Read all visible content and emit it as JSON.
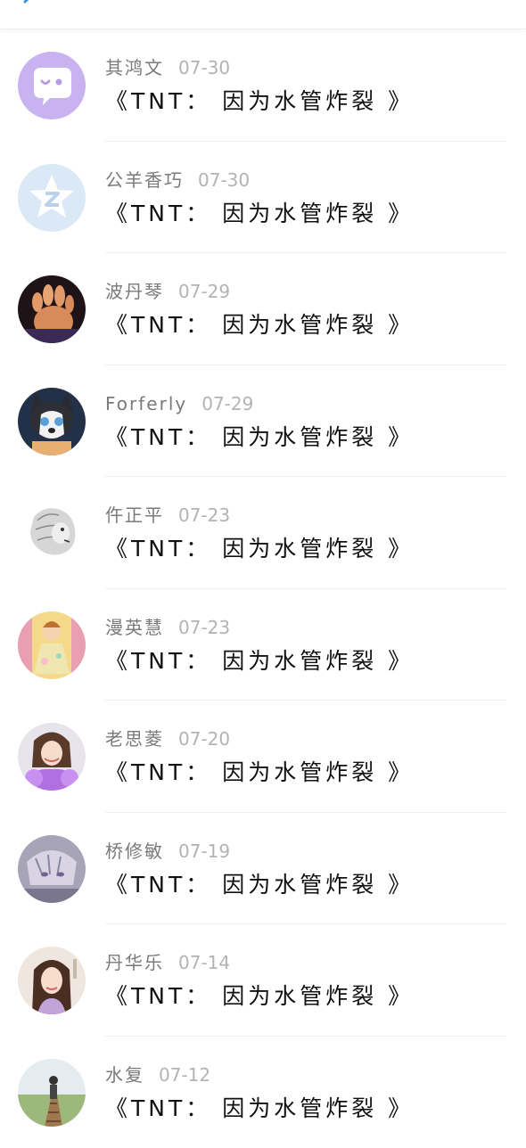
{
  "header": {
    "back_icon": "chevron-left-icon",
    "accent": "#3a8ee6"
  },
  "messages": [
    {
      "name": "其鸿文",
      "date": "07-30",
      "text": "《TNT： 因为水管炸裂 》",
      "avatar": "bubble-face"
    },
    {
      "name": "公羊香巧",
      "date": "07-30",
      "text": "《TNT： 因为水管炸裂 》",
      "avatar": "star-logo"
    },
    {
      "name": "波丹琴",
      "date": "07-29",
      "text": "《TNT： 因为水管炸裂 》",
      "avatar": "paw-photo"
    },
    {
      "name": "Forferly",
      "date": "07-29",
      "text": "《TNT： 因为水管炸裂 》",
      "avatar": "husky-cartoon"
    },
    {
      "name": "仵正平",
      "date": "07-23",
      "text": "《TNT： 因为水管炸裂 》",
      "avatar": "lion-sketch"
    },
    {
      "name": "漫英慧",
      "date": "07-23",
      "text": "《TNT： 因为水管炸裂 》",
      "avatar": "anime-girl-yellow"
    },
    {
      "name": "老思菱",
      "date": "07-20",
      "text": "《TNT： 因为水管炸裂 》",
      "avatar": "woman-purple"
    },
    {
      "name": "桥修敏",
      "date": "07-19",
      "text": "《TNT： 因为水管炸裂 》",
      "avatar": "anime-boy-grey"
    },
    {
      "name": "丹华乐",
      "date": "07-14",
      "text": "《TNT： 因为水管炸裂 》",
      "avatar": "woman-portrait"
    },
    {
      "name": "水复",
      "date": "07-12",
      "text": "《TNT： 因为水管炸裂 》",
      "avatar": "bridge-scene"
    }
  ]
}
